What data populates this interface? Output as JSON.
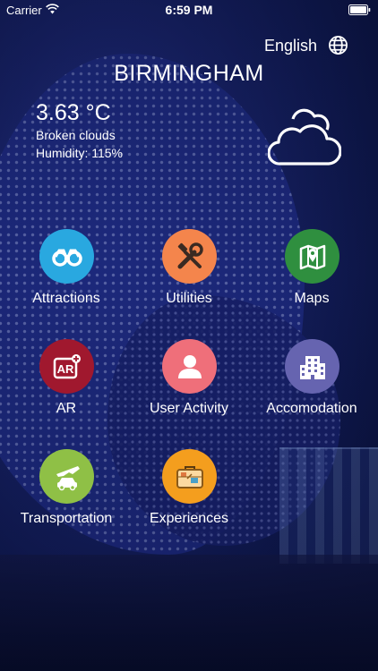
{
  "status_bar": {
    "carrier": "Carrier",
    "time": "6:59 PM"
  },
  "language": {
    "label": "English",
    "icon": "globe-icon"
  },
  "weather": {
    "city": "BIRMINGHAM",
    "temperature": "3.63 °C",
    "description": "Broken clouds",
    "humidity": "Humidity: 115%",
    "icon": "cloud-icon"
  },
  "menu": [
    {
      "label": "Attractions",
      "icon": "binoculars-icon",
      "color": "#29a8e0"
    },
    {
      "label": "Utilities",
      "icon": "tools-icon",
      "color": "#f4854c"
    },
    {
      "label": "Maps",
      "icon": "map-pin-icon",
      "color": "#2f8f3f"
    },
    {
      "label": "AR",
      "icon": "ar-badge-icon",
      "color": "#a0182e"
    },
    {
      "label": "User Activity",
      "icon": "user-icon",
      "color": "#ef6f7a"
    },
    {
      "label": "Accomodation",
      "icon": "building-icon",
      "color": "#6664b0"
    },
    {
      "label": "Transportation",
      "icon": "plane-car-icon",
      "color": "#8fc046"
    },
    {
      "label": "Experiences",
      "icon": "suitcase-icon",
      "color": "#f49e1e"
    }
  ]
}
